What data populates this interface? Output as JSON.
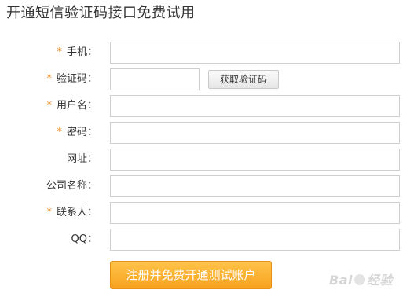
{
  "title": "开通短信验证码接口免费试用",
  "form": {
    "required_mark": "*",
    "mobile_label": "手机：",
    "captcha_label": "验证码：",
    "get_captcha_button": "获取验证码",
    "username_label": "用户名：",
    "password_label": "密码：",
    "website_label": "网址：",
    "company_label": "公司名称：",
    "contact_label": "联系人：",
    "qq_label": "QQ：",
    "mobile_value": "",
    "captcha_value": "",
    "username_value": "",
    "password_value": "",
    "website_value": "",
    "company_value": "",
    "contact_value": "",
    "qq_value": ""
  },
  "submit_button": "注册并免费开通测试账户",
  "watermark": {
    "brand_a": "Bai",
    "brand_b": "经验"
  }
}
